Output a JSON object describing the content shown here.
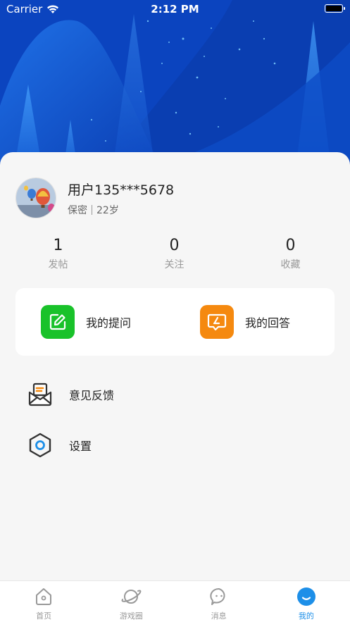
{
  "status_bar": {
    "carrier": "Carrier",
    "time": "2:12 PM"
  },
  "profile": {
    "username": "用户135***5678",
    "gender": "保密",
    "age": "22岁"
  },
  "stats": [
    {
      "value": "1",
      "label": "发帖"
    },
    {
      "value": "0",
      "label": "关注"
    },
    {
      "value": "0",
      "label": "收藏"
    }
  ],
  "quick_actions": [
    {
      "label": "我的提问",
      "icon": "edit-icon",
      "color": "#19c22a"
    },
    {
      "label": "我的回答",
      "icon": "answer-icon",
      "color": "#f5890f"
    }
  ],
  "menu": [
    {
      "label": "意见反馈",
      "icon": "feedback-mail-icon"
    },
    {
      "label": "设置",
      "icon": "settings-hexagon-icon"
    }
  ],
  "tabbar": {
    "active_color": "#1d8fe8",
    "items": [
      {
        "label": "首页",
        "icon": "home-icon"
      },
      {
        "label": "游戏圈",
        "icon": "planet-icon"
      },
      {
        "label": "消息",
        "icon": "chat-bubble-icon"
      },
      {
        "label": "我的",
        "icon": "smile-icon"
      }
    ]
  }
}
